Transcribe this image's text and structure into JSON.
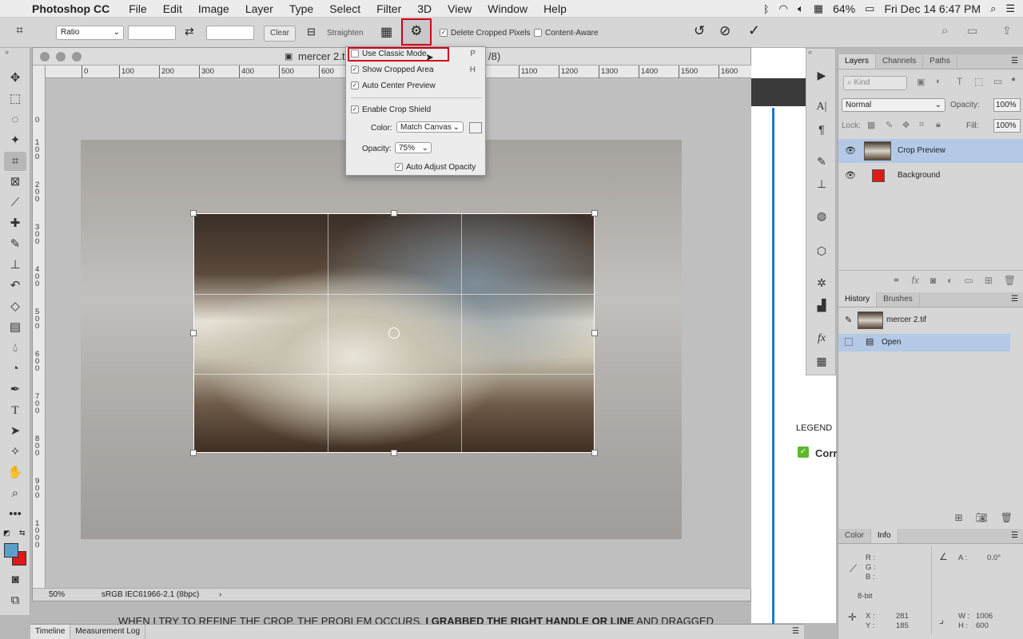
{
  "menubar": {
    "app": "Photoshop CC",
    "menus": [
      "File",
      "Edit",
      "Image",
      "Layer",
      "Type",
      "Select",
      "Filter",
      "3D",
      "View",
      "Window",
      "Help"
    ],
    "battery": "64%",
    "datetime": "Fri Dec 14  6:47 PM"
  },
  "options": {
    "ratio": "Ratio",
    "clear": "Clear",
    "straighten": "Straighten",
    "delete_cropped": "Delete Cropped Pixels",
    "content_aware": "Content-Aware"
  },
  "document": {
    "title": "mercer 2.t",
    "title_suffix": "/8)",
    "zoom": "50%",
    "profile": "sRGB IEC61966-2.1 (8bpc)",
    "ruler_h": [
      "0",
      "100",
      "200",
      "300",
      "400",
      "500",
      "600",
      "1100",
      "1200",
      "1300",
      "1400",
      "1500",
      "1600"
    ],
    "ruler_v": [
      "0",
      "1 0 0",
      "2 0 0",
      "3 0 0",
      "4 0 0",
      "5 0 0",
      "6 0 0",
      "7 0 0",
      "8 0 0",
      "9 0 0",
      "1 0 0 0"
    ]
  },
  "crop_menu": {
    "classic": {
      "label": "Use Classic Mode",
      "key": "P",
      "checked": false
    },
    "show_cropped": {
      "label": "Show Cropped Area",
      "key": "H",
      "checked": true
    },
    "auto_center": {
      "label": "Auto Center Preview",
      "checked": true
    },
    "shield": {
      "label": "Enable Crop Shield",
      "checked": true
    },
    "color_label": "Color:",
    "color_value": "Match Canvas",
    "opacity_label": "Opacity:",
    "opacity_value": "75%",
    "auto_adjust": {
      "label": "Auto Adjust Opacity",
      "checked": true
    }
  },
  "layers_panel": {
    "tabs": [
      "Layers",
      "Channels",
      "Paths"
    ],
    "kind": "Kind",
    "blend": "Normal",
    "opacity_label": "Opacity:",
    "opacity": "100%",
    "lock_label": "Lock:",
    "fill_label": "Fill:",
    "fill": "100%",
    "layers": [
      {
        "name": "Crop Preview",
        "selected": true
      },
      {
        "name": "Background",
        "selected": false
      }
    ]
  },
  "history_panel": {
    "tabs": [
      "History",
      "Brushes"
    ],
    "snapshot": "mercer 2.tif",
    "steps": [
      "Open"
    ]
  },
  "info_panel": {
    "tabs": [
      "Color",
      "Info"
    ],
    "r": "R :",
    "g": "G :",
    "b": "B :",
    "a_label": "A :",
    "a_value": "0.0°",
    "bit": "8-bit",
    "x_label": "X :",
    "x_value": "281",
    "y_label": "Y :",
    "y_value": "185",
    "w_label": "W :",
    "w_value": "1006",
    "h_label": "H :",
    "h_value": "600"
  },
  "background_page": {
    "legend": "LEGEND",
    "corr": "Corr",
    "caption_normal_1": "WHEN I TRY TO REFINE THE CROP, THE PROBLEM OCCURS. ",
    "caption_bold": "I GRABBED THE RIGHT HANDLE OR LINE",
    "caption_normal_2": " AND DRAGGED"
  },
  "bottom_tabs": [
    "Timeline",
    "Measurement Log"
  ],
  "colors": {
    "highlight": "#d0021b",
    "selection": "#b3c9e6",
    "fg": "#5aa0c8",
    "bg": "#e01818"
  }
}
